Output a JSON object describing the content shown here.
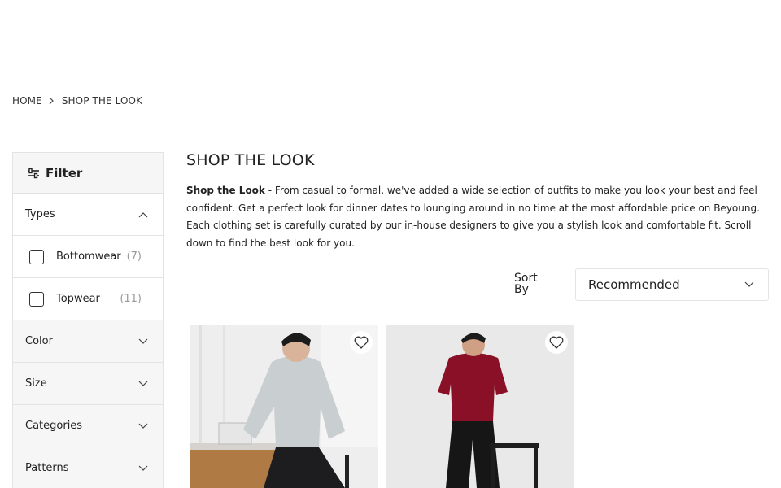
{
  "breadcrumb": {
    "home": "HOME",
    "current": "SHOP THE LOOK"
  },
  "sidebar": {
    "title": "Filter",
    "sections": {
      "types": {
        "label": "Types",
        "options": [
          {
            "label": "Bottomwear",
            "count": "(7)"
          },
          {
            "label": "Topwear",
            "count": "(11)"
          }
        ]
      },
      "color": {
        "label": "Color"
      },
      "size": {
        "label": "Size"
      },
      "categories": {
        "label": "Categories"
      },
      "patterns": {
        "label": "Patterns"
      }
    }
  },
  "main": {
    "title": "SHOP THE LOOK",
    "desc_lead": "Shop the Look",
    "desc_body": " - From casual to formal, we've added a wide selection of outfits to make you look your best and feel confident. Get a perfect look for dinner dates to lounging around in no time at the most affordable price on Beyoung. Each clothing set is carefully curated by our in-house designers to give you a stylish look and comfortable fit. Scroll down to find the best look for you.",
    "sort_label": "Sort By",
    "sort_value": "Recommended"
  },
  "products": [
    {
      "shirt_color": "#c9ced1",
      "pants_color": "#1d1d1f"
    },
    {
      "shirt_color": "#8a1027",
      "pants_color": "#161617"
    }
  ],
  "icons": {
    "filter": "sliders-icon",
    "wishlist": "heart-outline-icon",
    "chevron": "chevron-icon"
  }
}
